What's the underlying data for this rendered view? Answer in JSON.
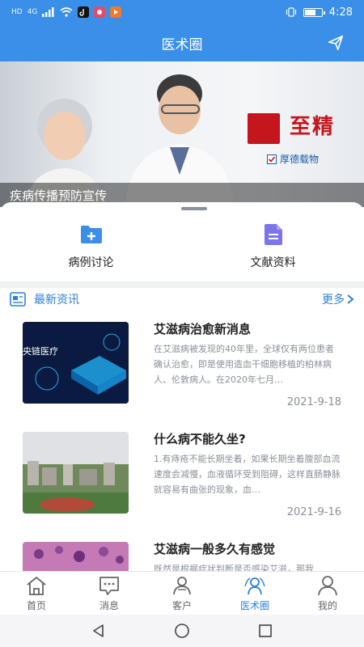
{
  "status_bar": {
    "network": "HD",
    "signal_label": "4G",
    "time": "4:28",
    "battery_level": 0.6
  },
  "header": {
    "title": "医术圈",
    "action_icon": "send-icon"
  },
  "banner": {
    "caption": "疾病传播预防宣传",
    "brand_text": "至精",
    "brand_sub": "厚德载物"
  },
  "quick_entries": [
    {
      "label": "病例讨论",
      "icon": "add-folder-icon"
    },
    {
      "label": "文献资料",
      "icon": "document-icon"
    }
  ],
  "news_section": {
    "title": "最新资讯",
    "more_label": "更多"
  },
  "news": [
    {
      "title": "艾滋病治愈新消息",
      "desc": "在艾滋病被发现的40年里，全球仅有两位患者确认治愈，即是使用造血干细胞移植的柏林病人、伦敦病人。在2020年七月…",
      "date": "2021-9-18",
      "thumb_text": "央链医疗"
    },
    {
      "title": "什么病不能久坐?",
      "desc": "1.有痔疮不能长期坐着，如果长期坐着腹部血流速度会减慢，血液循环受到阻碍，这样直肠静脉就容易有曲张的现象，血…",
      "date": "2021-9-16"
    },
    {
      "title": "艾滋病一般多久有感觉",
      "desc": "既然是根据症状判断是否感染艾滋，那我",
      "date": ""
    }
  ],
  "tabs": [
    {
      "label": "首页",
      "icon": "home-icon"
    },
    {
      "label": "消息",
      "icon": "message-icon"
    },
    {
      "label": "客户",
      "icon": "client-icon"
    },
    {
      "label": "医术圈",
      "icon": "medical-circle-icon",
      "active": true
    },
    {
      "label": "我的",
      "icon": "profile-icon"
    }
  ],
  "colors": {
    "primary": "#3a8fe8",
    "accent": "#2e7fd8",
    "text_secondary": "#8a8f98"
  }
}
